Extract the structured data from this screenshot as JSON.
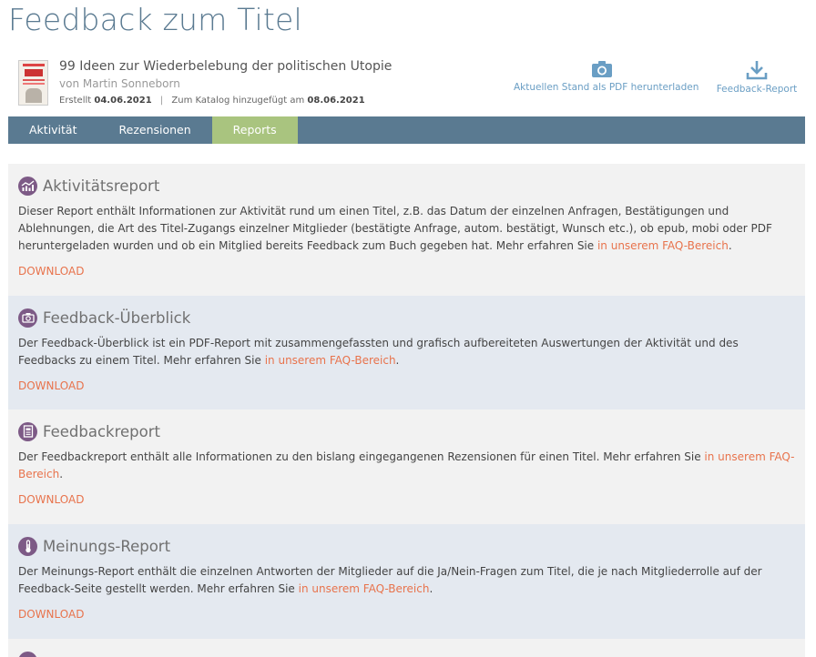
{
  "page": {
    "title": "Feedback zum Titel"
  },
  "book": {
    "title": "99 Ideen zur Wiederbelebung der politischen Utopie",
    "author": "von Martin Sonneborn",
    "created_label": "Erstellt",
    "created_date": "04.06.2021",
    "catalog_label": "Zum Katalog hinzugefügt am",
    "catalog_date": "08.06.2021",
    "separator": "|"
  },
  "actions": {
    "pdf_label": "Aktuellen Stand als PDF herunterladen",
    "feedback_label": "Feedback-Report"
  },
  "tabs": [
    {
      "label": "Aktivität",
      "active": false
    },
    {
      "label": "Rezensionen",
      "active": false
    },
    {
      "label": "Reports",
      "active": true
    }
  ],
  "reports": [
    {
      "icon": "chart-icon",
      "title": "Aktivitätsreport",
      "text": "Dieser Report enthält Informationen zur Aktivität rund um einen Titel, z.B. das Datum der einzelnen Anfragen, Bestätigungen und Ablehnungen, die Art des Titel-Zugangs einzelner Mitglieder (bestätigte Anfrage, autom. bestätigt, Wunsch etc.), ob epub, mobi oder PDF heruntergeladen wurden und ob ein Mitglied bereits Feedback zum Buch gegeben hat. Mehr erfahren Sie ",
      "link": "in unserem FAQ-Bereich",
      "after": ".",
      "download": "DOWNLOAD"
    },
    {
      "icon": "camera-icon",
      "title": "Feedback-Überblick",
      "text": "Der Feedback-Überblick ist ein PDF-Report mit zusammengefassten und grafisch aufbereiteten Auswertungen der Aktivität und des Feedbacks zu einem Titel. Mehr erfahren Sie ",
      "link": "in unserem FAQ-Bereich",
      "after": ".",
      "download": "DOWNLOAD"
    },
    {
      "icon": "document-icon",
      "title": "Feedbackreport",
      "text": "Der Feedbackreport enthält alle Informationen zu den bislang eingegangenen Rezensionen für einen Titel. Mehr erfahren Sie ",
      "link": "in unserem FAQ-Bereich",
      "after": ".",
      "download": "DOWNLOAD"
    },
    {
      "icon": "thermometer-icon",
      "title": "Meinungs-Report",
      "text": "Der Meinungs-Report enthält die einzelnen Antworten der Mitglieder auf die Ja/Nein-Fragen zum Titel, die je nach Mitgliederrolle auf der Feedback-Seite gestellt werden. Mehr erfahren Sie ",
      "link": "in unserem FAQ-Bereich",
      "after": ".",
      "download": "DOWNLOAD"
    }
  ],
  "colors": {
    "title": "#5a7a91",
    "tab_bar": "#5a7a91",
    "tab_active": "#a9c47f",
    "link": "#e8734c",
    "icon_circle": "#7d5a86",
    "action": "#6a9ec4"
  }
}
